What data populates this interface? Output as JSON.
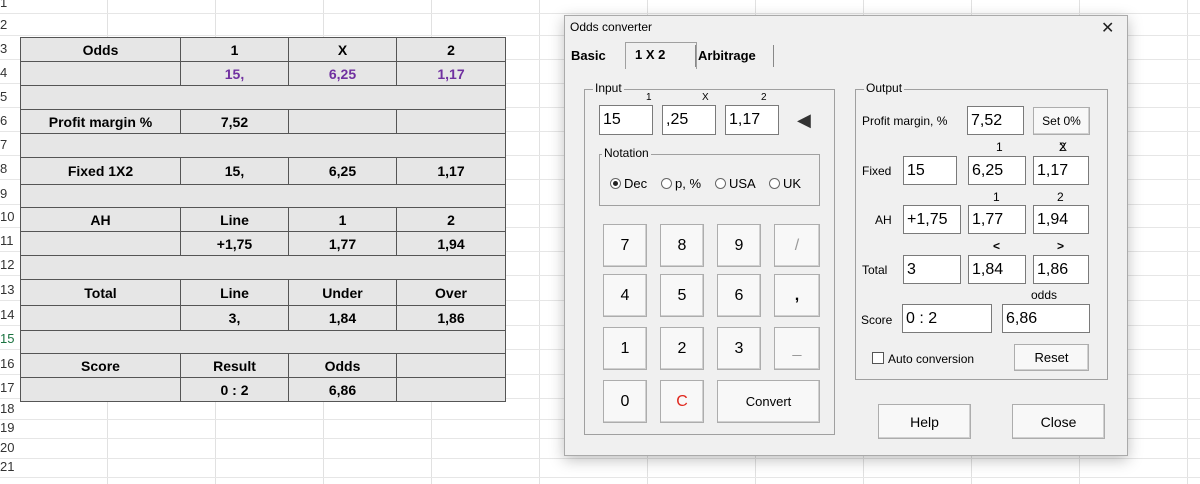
{
  "sheet": {
    "row_numbers": [
      "1",
      "2",
      "3",
      "4",
      "5",
      "6",
      "7",
      "8",
      "9",
      "10",
      "11",
      "12",
      "13",
      "14",
      "15",
      "16",
      "17",
      "18",
      "19",
      "20",
      "21"
    ],
    "odds_header": {
      "label": "Odds",
      "c1": "1",
      "cx": "X",
      "c2": "2"
    },
    "odds_values": {
      "c1": "15,",
      "cx": "6,25",
      "c2": "1,17"
    },
    "profit_margin": {
      "label": "Profit margin %",
      "value": "7,52"
    },
    "fixed": {
      "label": "Fixed 1X2",
      "c1": "15,",
      "cx": "6,25",
      "c2": "1,17"
    },
    "ah_header": {
      "label": "AH",
      "c1": "Line",
      "cx": "1",
      "c2": "2"
    },
    "ah_values": {
      "c1": "+1,75",
      "cx": "1,77",
      "c2": "1,94"
    },
    "total_header": {
      "label": "Total",
      "c1": "Line",
      "cx": "Under",
      "c2": "Over"
    },
    "total_values": {
      "c1": "3,",
      "cx": "1,84",
      "c2": "1,86"
    },
    "score_header": {
      "label": "Score",
      "c1": "Result",
      "cx": "Odds"
    },
    "score_values": {
      "c1": "0 : 2",
      "cx": "6,86"
    },
    "accent_purple": "#7030a0"
  },
  "dialog": {
    "title": "Odds converter",
    "close_glyph": "✕",
    "tabs": [
      "Basic",
      "1 X 2",
      "Arbitrage"
    ],
    "input": {
      "group_title": "Input",
      "col_labels": [
        "1",
        "X",
        "2"
      ],
      "values": [
        "15",
        ",25",
        "1,17"
      ],
      "arrow_glyph": "◀"
    },
    "notation": {
      "title": "Notation",
      "options": [
        "Dec",
        "p, %",
        "USA",
        "UK"
      ],
      "selected": "Dec"
    },
    "keypad": {
      "row1": [
        "7",
        "8",
        "9",
        "/"
      ],
      "row2": [
        "4",
        "5",
        "6",
        ","
      ],
      "row3": [
        "1",
        "2",
        "3",
        "_"
      ],
      "zero": "0",
      "clear": "C",
      "convert": "Convert"
    },
    "output": {
      "group_title": "Output",
      "profit_margin_label": "Profit margin, %",
      "profit_margin_value": "7,52",
      "set0_label": "Set 0%",
      "fixed_cols": [
        "1",
        "X",
        "2"
      ],
      "fixed_label": "Fixed",
      "fixed_values": [
        "15",
        "6,25",
        "1,17"
      ],
      "ah_cols": [
        "1",
        "2"
      ],
      "ah_label": "AH",
      "ah_values": [
        "+1,75",
        "1,77",
        "1,94"
      ],
      "total_cols": [
        "<",
        ">"
      ],
      "total_label": "Total",
      "total_values": [
        "3",
        "1,84",
        "1,86"
      ],
      "odds_col": "odds",
      "score_label": "Score",
      "score_value": "0 : 2",
      "score_odds": "6,86",
      "auto_conversion_label": "Auto conversion",
      "reset_label": "Reset"
    },
    "help_label": "Help",
    "close_label": "Close"
  }
}
